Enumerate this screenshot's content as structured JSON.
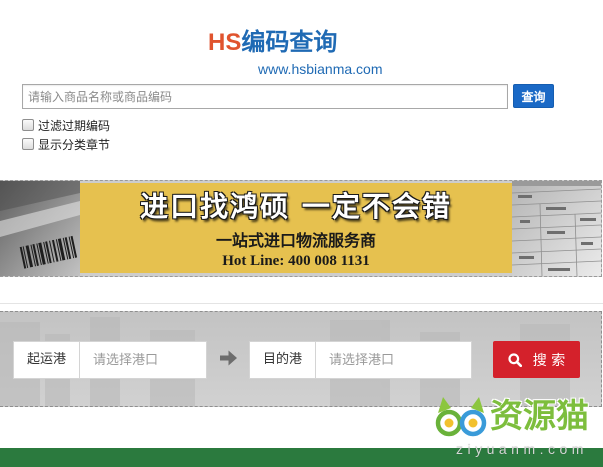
{
  "logo": {
    "prefix": "HS",
    "title": "编码查询",
    "url": "www.hsbianma.com",
    "prefix_color": "#e0542e",
    "title_color": "#1f6ab4"
  },
  "search": {
    "placeholder": "请输入商品名称或商品编码",
    "value": "",
    "button_label": "查询",
    "button_color": "#1a69c6"
  },
  "options": [
    {
      "label": "过滤过期编码",
      "checked": false
    },
    {
      "label": "显示分类章节",
      "checked": false
    }
  ],
  "banner": {
    "headline": "进口找鸿硕 一定不会错",
    "tagline": "一站式进口物流服务商",
    "hotline": "Hot Line: 400 008 1131",
    "accent_color": "#e6c14f"
  },
  "port_search": {
    "origin_label": "起运港",
    "origin_placeholder": "请选择港口",
    "origin_value": "",
    "separator_icon": "arrow-right-icon",
    "destination_label": "目的港",
    "destination_placeholder": "请选择港口",
    "destination_value": "",
    "button_icon": "search-icon",
    "button_label": "搜 索",
    "button_color": "#d4212b"
  },
  "footer": {
    "color": "#2b7a3e"
  },
  "watermark": {
    "logo_icon": "cat-logo-icon",
    "name": "资源猫",
    "url": "ziyuanm.com"
  }
}
